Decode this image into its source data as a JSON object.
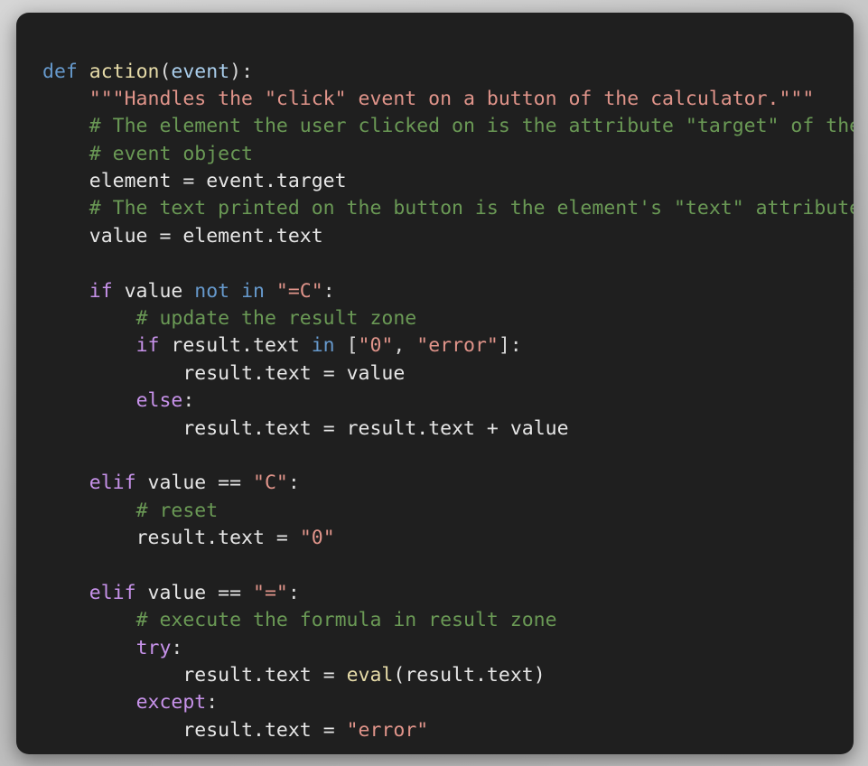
{
  "editor": {
    "language": "python",
    "theme": "dark",
    "background": "#1f1f1f",
    "page_background": "#c9c9c9",
    "colors": {
      "plain": "#e6e6e6",
      "keyword": "#c792ea",
      "keyword_operator": "#6699cc",
      "def_keyword": "#6699cc",
      "function_name": "#e6dba8",
      "parameter": "#a9cdeb",
      "string": "#e0948a",
      "number": "#e8a16a",
      "comment": "#6a9955"
    }
  },
  "code": {
    "lines": [
      {
        "indent": 0,
        "tokens": [
          {
            "t": "def",
            "c": "t-def"
          },
          {
            "t": " ",
            "c": "t-plain"
          },
          {
            "t": "action",
            "c": "t-fn"
          },
          {
            "t": "(",
            "c": "t-punct"
          },
          {
            "t": "event",
            "c": "t-param"
          },
          {
            "t": "):",
            "c": "t-punct"
          }
        ]
      },
      {
        "indent": 1,
        "tokens": [
          {
            "t": "\"\"\"Handles the \"click\" event on a button of the calculator.\"\"\"",
            "c": "t-doc"
          }
        ]
      },
      {
        "indent": 1,
        "tokens": [
          {
            "t": "# The element the user clicked on is the attribute \"target\" of the",
            "c": "t-comment"
          }
        ]
      },
      {
        "indent": 1,
        "tokens": [
          {
            "t": "# event object",
            "c": "t-comment"
          }
        ]
      },
      {
        "indent": 1,
        "tokens": [
          {
            "t": "element ",
            "c": "t-plain"
          },
          {
            "t": "=",
            "c": "t-op"
          },
          {
            "t": " event.target",
            "c": "t-plain"
          }
        ]
      },
      {
        "indent": 1,
        "tokens": [
          {
            "t": "# The text printed on the button is the element's \"text\" attribute",
            "c": "t-comment"
          }
        ]
      },
      {
        "indent": 1,
        "tokens": [
          {
            "t": "value ",
            "c": "t-plain"
          },
          {
            "t": "=",
            "c": "t-op"
          },
          {
            "t": " element.text",
            "c": "t-plain"
          }
        ]
      },
      {
        "indent": 0,
        "tokens": []
      },
      {
        "indent": 1,
        "tokens": [
          {
            "t": "if",
            "c": "t-kw"
          },
          {
            "t": " value ",
            "c": "t-plain"
          },
          {
            "t": "not",
            "c": "t-kw2"
          },
          {
            "t": " ",
            "c": "t-plain"
          },
          {
            "t": "in",
            "c": "t-kw2"
          },
          {
            "t": " ",
            "c": "t-plain"
          },
          {
            "t": "\"=C\"",
            "c": "t-str"
          },
          {
            "t": ":",
            "c": "t-punct"
          }
        ]
      },
      {
        "indent": 2,
        "tokens": [
          {
            "t": "# update the result zone",
            "c": "t-comment"
          }
        ]
      },
      {
        "indent": 2,
        "tokens": [
          {
            "t": "if",
            "c": "t-kw"
          },
          {
            "t": " result.text ",
            "c": "t-plain"
          },
          {
            "t": "in",
            "c": "t-kw2"
          },
          {
            "t": " [",
            "c": "t-punct"
          },
          {
            "t": "\"0\"",
            "c": "t-str"
          },
          {
            "t": ", ",
            "c": "t-punct"
          },
          {
            "t": "\"error\"",
            "c": "t-str"
          },
          {
            "t": "]:",
            "c": "t-punct"
          }
        ]
      },
      {
        "indent": 3,
        "tokens": [
          {
            "t": "result.text ",
            "c": "t-plain"
          },
          {
            "t": "=",
            "c": "t-op"
          },
          {
            "t": " value",
            "c": "t-plain"
          }
        ]
      },
      {
        "indent": 2,
        "tokens": [
          {
            "t": "else",
            "c": "t-kw"
          },
          {
            "t": ":",
            "c": "t-punct"
          }
        ]
      },
      {
        "indent": 3,
        "tokens": [
          {
            "t": "result.text ",
            "c": "t-plain"
          },
          {
            "t": "=",
            "c": "t-op"
          },
          {
            "t": " result.text ",
            "c": "t-plain"
          },
          {
            "t": "+",
            "c": "t-op"
          },
          {
            "t": " value",
            "c": "t-plain"
          }
        ]
      },
      {
        "indent": 0,
        "tokens": []
      },
      {
        "indent": 1,
        "tokens": [
          {
            "t": "elif",
            "c": "t-kw"
          },
          {
            "t": " value ",
            "c": "t-plain"
          },
          {
            "t": "==",
            "c": "t-op"
          },
          {
            "t": " ",
            "c": "t-plain"
          },
          {
            "t": "\"C\"",
            "c": "t-str"
          },
          {
            "t": ":",
            "c": "t-punct"
          }
        ]
      },
      {
        "indent": 2,
        "tokens": [
          {
            "t": "# reset",
            "c": "t-comment"
          }
        ]
      },
      {
        "indent": 2,
        "tokens": [
          {
            "t": "result.text ",
            "c": "t-plain"
          },
          {
            "t": "=",
            "c": "t-op"
          },
          {
            "t": " ",
            "c": "t-plain"
          },
          {
            "t": "\"0\"",
            "c": "t-str"
          }
        ]
      },
      {
        "indent": 0,
        "tokens": []
      },
      {
        "indent": 1,
        "tokens": [
          {
            "t": "elif",
            "c": "t-kw"
          },
          {
            "t": " value ",
            "c": "t-plain"
          },
          {
            "t": "==",
            "c": "t-op"
          },
          {
            "t": " ",
            "c": "t-plain"
          },
          {
            "t": "\"=\"",
            "c": "t-str"
          },
          {
            "t": ":",
            "c": "t-punct"
          }
        ]
      },
      {
        "indent": 2,
        "tokens": [
          {
            "t": "# execute the formula in result zone",
            "c": "t-comment"
          }
        ]
      },
      {
        "indent": 2,
        "tokens": [
          {
            "t": "try",
            "c": "t-kw"
          },
          {
            "t": ":",
            "c": "t-punct"
          }
        ]
      },
      {
        "indent": 3,
        "tokens": [
          {
            "t": "result.text ",
            "c": "t-plain"
          },
          {
            "t": "=",
            "c": "t-op"
          },
          {
            "t": " ",
            "c": "t-plain"
          },
          {
            "t": "eval",
            "c": "t-fn"
          },
          {
            "t": "(result.text)",
            "c": "t-plain"
          }
        ]
      },
      {
        "indent": 2,
        "tokens": [
          {
            "t": "except",
            "c": "t-kw"
          },
          {
            "t": ":",
            "c": "t-punct"
          }
        ]
      },
      {
        "indent": 3,
        "tokens": [
          {
            "t": "result.text ",
            "c": "t-plain"
          },
          {
            "t": "=",
            "c": "t-op"
          },
          {
            "t": " ",
            "c": "t-plain"
          },
          {
            "t": "\"error\"",
            "c": "t-str"
          }
        ]
      }
    ],
    "plain_text": "def action(event):\n    \"\"\"Handles the \"click\" event on a button of the calculator.\"\"\"\n    # The element the user clicked on is the attribute \"target\" of the\n    # event object\n    element = event.target\n    # The text printed on the button is the element's \"text\" attribute\n    value = element.text\n\n    if value not in \"=C\":\n        # update the result zone\n        if result.text in [\"0\", \"error\"]:\n            result.text = value\n        else:\n            result.text = result.text + value\n\n    elif value == \"C\":\n        # reset\n        result.text = \"0\"\n\n    elif value == \"=\":\n        # execute the formula in result zone\n        try:\n            result.text = eval(result.text)\n        except:\n            result.text = \"error\"\n"
  }
}
